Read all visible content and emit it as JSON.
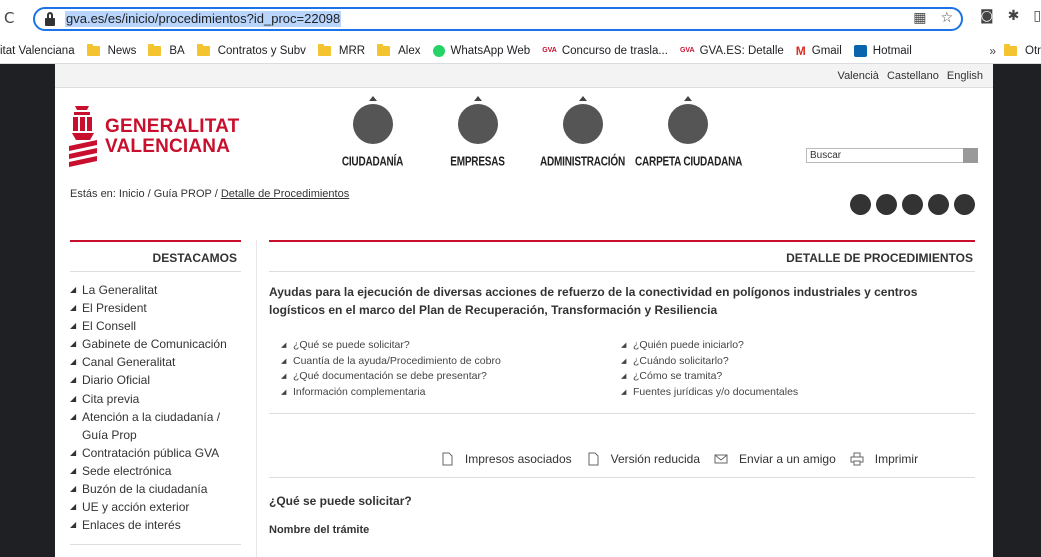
{
  "browser": {
    "reload_icon": "C",
    "url": "gva.es/es/inicio/procedimientos?id_proc=22098",
    "bookmarks": [
      {
        "label": "itat Valenciana",
        "icon": "none"
      },
      {
        "label": "News",
        "icon": "folder-icon"
      },
      {
        "label": "BA",
        "icon": "folder-icon"
      },
      {
        "label": "Contratos y Subv",
        "icon": "folder-icon"
      },
      {
        "label": "MRR",
        "icon": "folder-icon"
      },
      {
        "label": "Alex",
        "icon": "folder-icon"
      },
      {
        "label": "WhatsApp Web",
        "icon": "whatsapp-icon"
      },
      {
        "label": "Concurso de trasla...",
        "icon": "gva-icon"
      },
      {
        "label": "GVA.ES: Detalle",
        "icon": "gva-icon"
      },
      {
        "label": "Gmail",
        "icon": "gmail-icon"
      },
      {
        "label": "Hotmail",
        "icon": "outlook-icon"
      }
    ],
    "gva_icon_text": "GVA",
    "gmail_icon_text": "M",
    "more_label": "»",
    "other_bookmarks": "Otr"
  },
  "header": {
    "languages": [
      "Valencià",
      "Castellano",
      "English"
    ],
    "logo_line1": "GENERALITAT",
    "logo_line2": "VALENCIANA",
    "nav": [
      {
        "label": "CIUDADANÍA",
        "icon": "citizens-icon"
      },
      {
        "label": "EMPRESAS",
        "icon": "building-icon"
      },
      {
        "label": "ADMINISTRACIÓN",
        "icon": "handshake-icon"
      },
      {
        "label": "CARPETA CIUDADANA",
        "icon": "card-icon"
      }
    ],
    "search_value": "Buscar"
  },
  "breadcrumb": {
    "prefix": "Estás en: Inicio / Guía PROP / ",
    "current": "Detalle de Procedimientos"
  },
  "social": [
    "iv-icon",
    "twitter-icon",
    "youtube-icon",
    "facebook-icon",
    "flickr-icon"
  ],
  "sidebar": {
    "title": "DESTACAMOS",
    "items": [
      "La Generalitat",
      "El President",
      "El Consell",
      "Gabinete de Comunicación",
      "Canal Generalitat",
      "Diario Oficial",
      "Cita previa",
      "Atención a la ciudadanía /",
      "Guía Prop",
      "Contratación pública GVA",
      "Sede electrónica",
      "Buzón de la ciudadanía",
      "UE y acción exterior",
      "Enlaces de interés"
    ]
  },
  "main": {
    "title": "DETALLE DE PROCEDIMIENTOS",
    "heading": "Ayudas para la ejecución de diversas acciones de refuerzo de la conectividad en polígonos industriales y centros logísticos en el marco del Plan de Recuperación, Transformación y Resiliencia",
    "left_links": [
      "¿Qué se puede solicitar?",
      "Cuantía de la ayuda/Procedimiento de cobro",
      "¿Qué documentación se debe presentar?",
      "Información complementaria"
    ],
    "right_links": [
      "¿Quién puede iniciarlo?",
      "¿Cuándo solicitarlo?",
      "¿Cómo se tramita?",
      "Fuentes jurídicas y/o documentales"
    ],
    "actions": [
      "Impresos asociados",
      "Versión reducida",
      "Enviar a un amigo",
      "Imprimir"
    ],
    "section1": "¿Qué se puede solicitar?",
    "section2": "Nombre del trámite"
  },
  "colors": {
    "brand_red": "#c8102e",
    "focus_blue": "#1a73e8",
    "background_dark": "#1f2023"
  }
}
